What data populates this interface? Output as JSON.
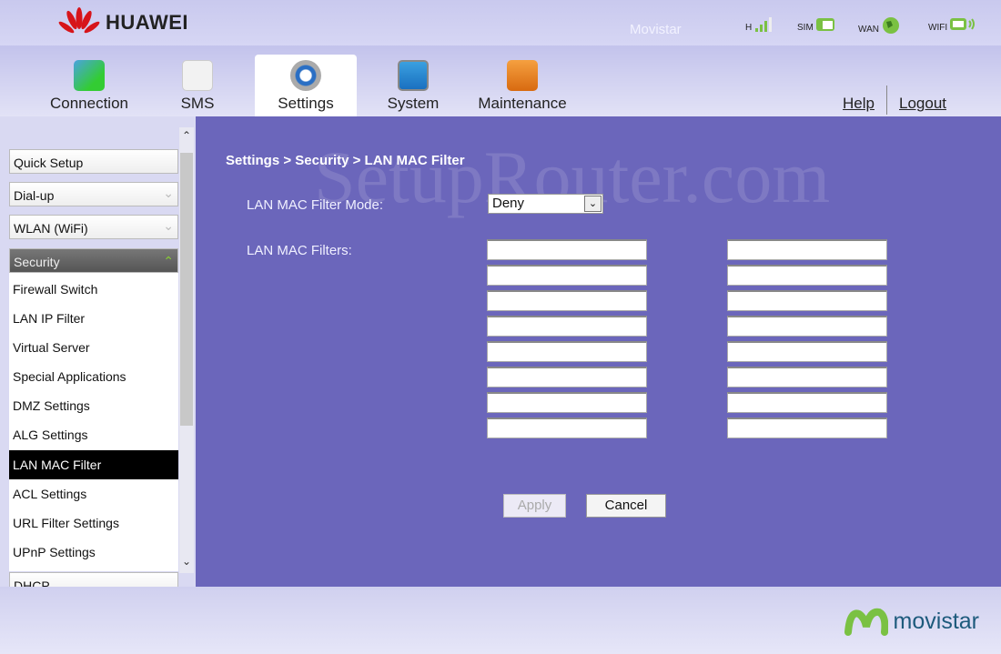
{
  "header": {
    "brand": "HUAWEI",
    "carrier": "Movistar",
    "status": [
      {
        "label": "H",
        "icon": "signal-icon"
      },
      {
        "label": "SIM",
        "icon": "sim-icon"
      },
      {
        "label": "WAN",
        "icon": "globe-icon"
      },
      {
        "label": "WIFI",
        "icon": "wifi-icon"
      }
    ]
  },
  "nav": {
    "tabs": [
      {
        "label": "Connection"
      },
      {
        "label": "SMS"
      },
      {
        "label": "Settings",
        "active": true
      },
      {
        "label": "System"
      },
      {
        "label": "Maintenance"
      }
    ],
    "help": "Help",
    "logout": "Logout"
  },
  "sidebar": {
    "groups": [
      "Quick Setup",
      "Dial-up",
      "WLAN (WiFi)",
      "Security"
    ],
    "items": [
      "Firewall Switch",
      "LAN IP Filter",
      "Virtual Server",
      "Special Applications",
      "DMZ Settings",
      "ALG Settings",
      "LAN MAC Filter",
      "ACL Settings",
      "URL Filter Settings",
      "UPnP Settings"
    ],
    "next_group": "DHCP",
    "selected": "LAN MAC Filter"
  },
  "main": {
    "watermark": "SetupRouter.com",
    "breadcrumb": "Settings > Security > LAN MAC Filter",
    "mode_label": "LAN MAC Filter Mode:",
    "mode_value": "Deny",
    "filters_label": "LAN MAC Filters:",
    "filters_left": [
      "",
      "",
      "",
      "",
      "",
      "",
      "",
      ""
    ],
    "filters_right": [
      "",
      "",
      "",
      "",
      "",
      "",
      "",
      ""
    ],
    "apply": "Apply",
    "cancel": "Cancel"
  },
  "footer": {
    "brand": "movistar"
  },
  "colors": {
    "content_bg": "#6b66bb",
    "accent_green": "#7ac143",
    "selected_item": "#000000"
  }
}
